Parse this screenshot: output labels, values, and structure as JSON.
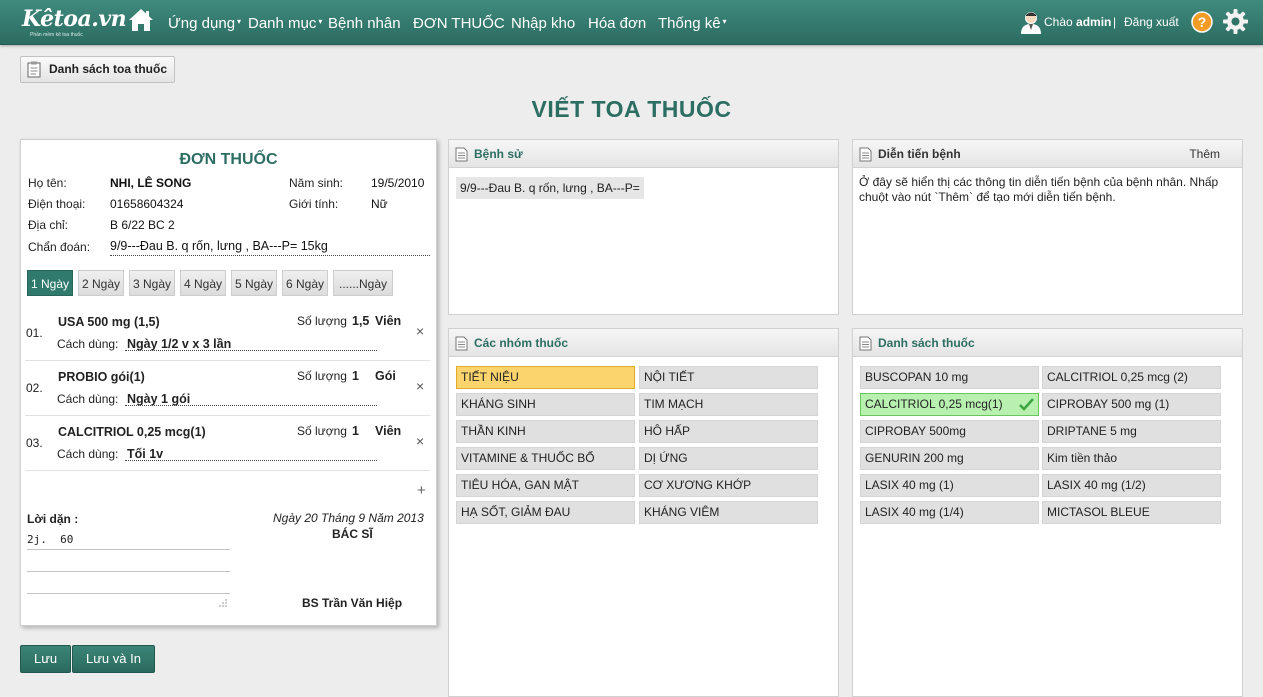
{
  "navbar": {
    "logo_text": "Kêtoa.vn",
    "logo_sub": "Phần mềm kê toa thuốc",
    "menu": [
      {
        "label": "Ứng dụng",
        "dropdown": true
      },
      {
        "label": "Danh mục",
        "dropdown": true
      },
      {
        "label": "Bệnh nhân",
        "dropdown": false
      },
      {
        "label": "ĐƠN THUỐC",
        "dropdown": false
      },
      {
        "label": "Nhập kho",
        "dropdown": false
      },
      {
        "label": "Hóa đơn",
        "dropdown": false
      },
      {
        "label": "Thống kê",
        "dropdown": true
      }
    ],
    "caret": "▾",
    "greeting": "Chào",
    "username": "admin",
    "separator": "|",
    "logout": "Đăng xuất",
    "help_symbol": "?"
  },
  "toolbar": {
    "list_button": "Danh sách toa thuốc"
  },
  "page_title": "VIẾT TOA THUỐC",
  "prescription": {
    "title": "ĐƠN THUỐC",
    "name_label": "Họ tên:",
    "name": "NHI, LÊ SONG",
    "birth_label": "Năm sinh:",
    "birth": "19/5/2010",
    "phone_label": "Điện thoại:",
    "phone": "01658604324",
    "gender_label": "Giới tính:",
    "gender": "Nữ",
    "address_label": "Địa chỉ:",
    "address": "B 6/22 BC 2",
    "diagnosis_label": "Chẩn đoán:",
    "diagnosis": "9/9---Đau B. q rốn, lưng , BA---P= 15kg",
    "days": [
      "1 Ngày",
      "2 Ngày",
      "3 Ngày",
      "4 Ngày",
      "5 Ngày",
      "6 Ngày",
      "......Ngày"
    ],
    "active_day": "1 Ngày",
    "qty_label": "Số lượng",
    "usage_label": "Cách dùng:",
    "medicines": [
      {
        "no": "01.",
        "name": "USA 500 mg (1,5)",
        "qty": "1,5",
        "unit": "Viên",
        "usage": "Ngày 1/2 v  x 3 lần"
      },
      {
        "no": "02.",
        "name": "PROBIO gói(1)",
        "qty": "1",
        "unit": "Gói",
        "usage": "Ngày 1 gói"
      },
      {
        "no": "03.",
        "name": "CALCITRIOL 0,25 mcg(1)",
        "qty": "1",
        "unit": "Viên",
        "usage": "Tối 1v"
      }
    ],
    "remove_symbol": "×",
    "add_symbol": "+",
    "note_label": "Lời dặn :",
    "note_value": "2j.  60",
    "date_text": "Ngày 20 Tháng 9 Năm 2013",
    "doctor_label": "BÁC SĨ",
    "doctor_name": "BS Trần Văn Hiệp"
  },
  "buttons": {
    "save": "Lưu",
    "save_print": "Lưu và In"
  },
  "history_panel": {
    "title": "Bệnh sử",
    "entry": "9/9---Đau B. q rốn, lưng , BA---P="
  },
  "progress_panel": {
    "title": "Diễn tiến bệnh",
    "add_label": "Thêm",
    "info": "Ở đây sẽ hiển thị các thông tin diễn tiến bệnh của bệnh nhân. Nhấp chuột vào nút `Thêm` để tạo mới diễn tiến bệnh."
  },
  "groups_panel": {
    "title": "Các nhóm thuốc",
    "items": [
      "TIẾT NIỆU",
      "NỘI TIẾT",
      "KHÁNG SINH",
      "TIM MẠCH",
      "THẦN KINH",
      "HÔ HẤP",
      "VITAMINE & THUỐC BỔ",
      "DỊ ỨNG",
      "TIÊU HÓA, GAN MẬT",
      "CƠ XƯƠNG KHỚP",
      "HẠ SỐT, GIẢM ĐAU",
      "KHÁNG VIÊM"
    ],
    "selected": "TIẾT NIỆU"
  },
  "drugs_panel": {
    "title": "Danh sách thuốc",
    "items": [
      "BUSCOPAN 10 mg",
      "CALCITRIOL 0,25 mcg (2)",
      "CALCITRIOL 0,25 mcg(1)",
      "CIPROBAY 500 mg (1)",
      "CIPROBAY 500mg",
      "DRIPTANE 5 mg",
      "GENURIN 200 mg",
      "Kim tiền thảo",
      "LASIX 40 mg (1)",
      "LASIX 40 mg (1/2)",
      "LASIX 40 mg (1/4)",
      "MICTASOL BLEUE"
    ],
    "selected": "CALCITRIOL 0,25 mcg(1)"
  },
  "colors": {
    "brand": "#2f7a6d",
    "selected_group": "#fcd46e",
    "selected_drug": "#b8f0b0"
  }
}
